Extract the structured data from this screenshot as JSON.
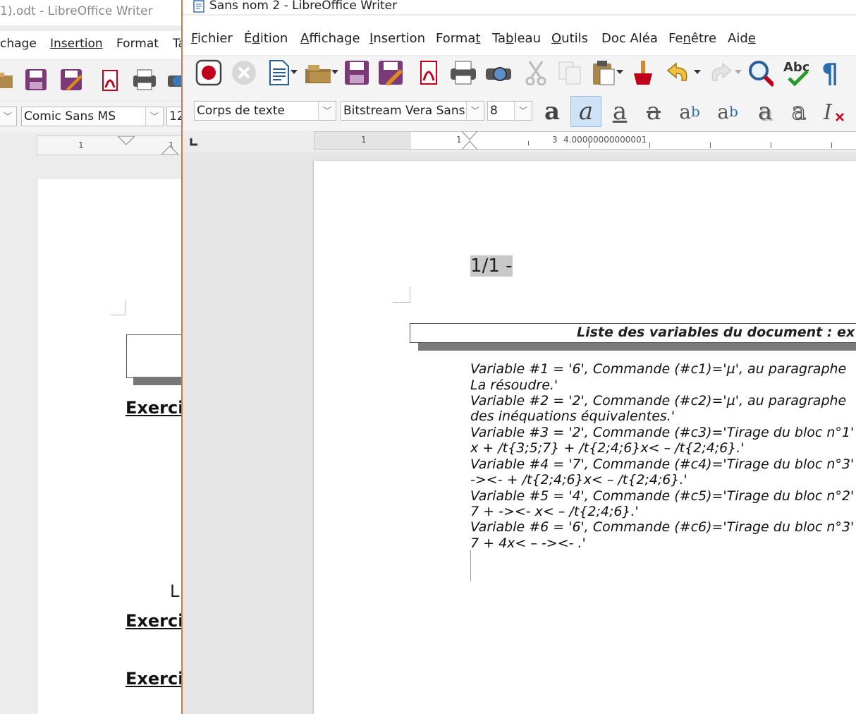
{
  "back_window": {
    "title": "1).odt - LibreOffice Writer",
    "menus": [
      "chage",
      "Insertion",
      "Format",
      "Ta"
    ],
    "font_name": "Comic Sans MS",
    "font_size": "12",
    "ruler_number": "1",
    "ruler_number_2": "1",
    "exercise_labels": [
      "Exerci",
      "Exerci",
      "Exerci"
    ],
    "letter": "L"
  },
  "front_window": {
    "title": "Sans nom 2 - LibreOffice Writer",
    "menus": [
      {
        "pre": "",
        "acc": "F",
        "post": "ichier"
      },
      {
        "pre": "É",
        "acc": "d",
        "post": "ition"
      },
      {
        "pre": "",
        "acc": "A",
        "post": "ffichage"
      },
      {
        "pre": "",
        "acc": "I",
        "post": "nsertion"
      },
      {
        "pre": "Forma",
        "acc": "t",
        "post": ""
      },
      {
        "pre": "Ta",
        "acc": "b",
        "post": "leau"
      },
      {
        "pre": "",
        "acc": "O",
        "post": "utils"
      },
      {
        "pre": "Doc Aléa",
        "acc": "",
        "post": ""
      },
      {
        "pre": "Fe",
        "acc": "n",
        "post": "être"
      },
      {
        "pre": "Aid",
        "acc": "e",
        "post": ""
      }
    ],
    "paragraph_style": "Corps de texte",
    "font_name": "Bitstream Vera Sans",
    "font_size": "8",
    "ruler": {
      "n1": "1",
      "n2": "1",
      "n3": "3",
      "value": "4.00000000000001"
    },
    "page": {
      "header": "1/1 -",
      "box_title": "Liste des variables du document : ex",
      "lines": [
        "Variable #1 = '6', Commande (#c1)='µ', au paragraphe",
        "La résoudre.'",
        "Variable #2 = '2', Commande (#c2)='µ', au paragraphe",
        "des inéquations équivalentes.'",
        "Variable #3 = '2', Commande (#c3)='Tirage du bloc n°1'",
        "x + /t{3;5;7} + /t{2;4;6}x< – /t{2;4;6}.'",
        "Variable #4 = '7', Commande (#c4)='Tirage du bloc n°3'",
        "-><-  + /t{2;4;6}x< – /t{2;4;6}.'",
        "Variable #5 = '4', Commande (#c5)='Tirage du bloc n°2'",
        "7 +  -><- x< – /t{2;4;6}.'",
        "Variable #6 = '6', Commande (#c6)='Tirage du bloc n°3'",
        "7 + 4x< –  -><- .'"
      ]
    }
  },
  "colors": {
    "accent_border": "#c77a52",
    "active_button": "#cfe3f7",
    "red_record": "#c0001a"
  }
}
